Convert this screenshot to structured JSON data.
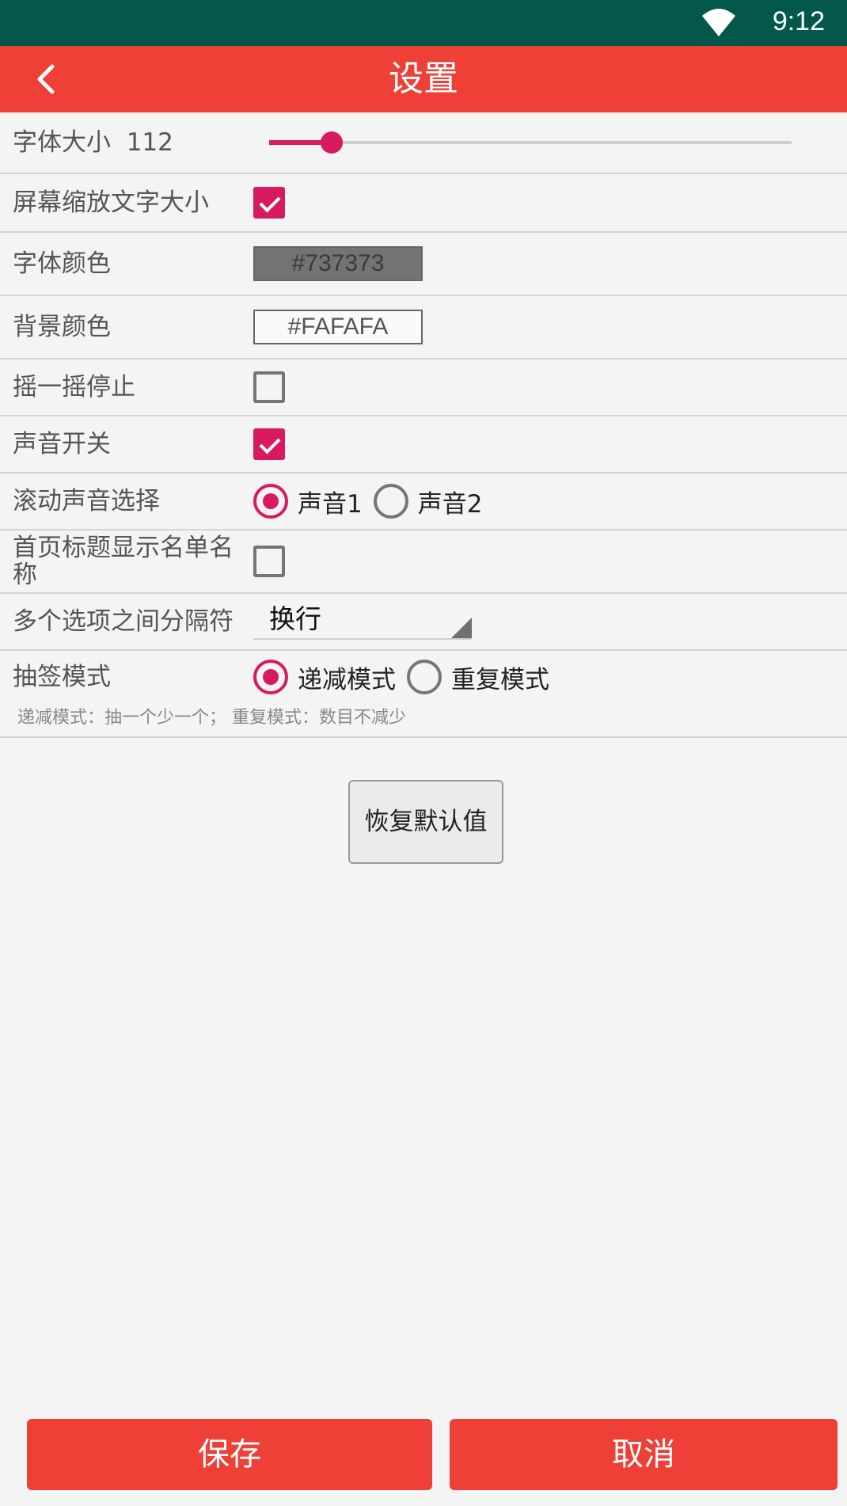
{
  "status_bar": {
    "time": "9:12"
  },
  "app_bar": {
    "title": "设置"
  },
  "settings": {
    "font_size": {
      "label": "字体大小  112",
      "value": 112,
      "slider_fraction": 0.12
    },
    "scale_text": {
      "label": "屏幕缩放文字大小",
      "checked": true
    },
    "font_color": {
      "label": "字体颜色",
      "value": "#737373"
    },
    "bg_color": {
      "label": "背景颜色",
      "value": "#FAFAFA"
    },
    "shake_stop": {
      "label": "摇一摇停止",
      "checked": false
    },
    "sound_switch": {
      "label": "声音开关",
      "checked": true
    },
    "scroll_sound": {
      "label": "滚动声音选择",
      "options": [
        "声音1",
        "声音2"
      ],
      "selected": 0
    },
    "show_list_name": {
      "label": "首页标题显示名单名称",
      "checked": false
    },
    "separator": {
      "label": "多个选项之间分隔符",
      "value": "换行"
    },
    "draw_mode": {
      "label": "抽签模式",
      "options": [
        "递减模式",
        "重复模式"
      ],
      "selected": 0,
      "hint": "递减模式：抽一个少一个；  重复模式：数目不减少"
    }
  },
  "buttons": {
    "restore": "恢复默认值",
    "save": "保存",
    "cancel": "取消"
  },
  "colors": {
    "status_bar": "#03584a",
    "app_bar": "#ee4036",
    "accent": "#d81b60"
  }
}
